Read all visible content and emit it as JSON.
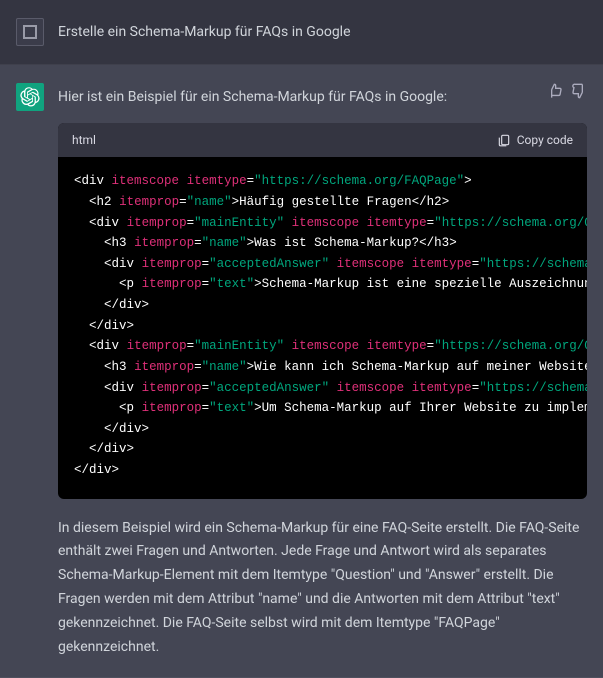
{
  "user": {
    "prompt": "Erstelle ein Schema-Markup für FAQs in Google"
  },
  "assistant": {
    "intro": "Hier ist ein Beispiel für ein Schema-Markup für FAQs in Google:",
    "explanation": "In diesem Beispiel wird ein Schema-Markup für eine FAQ-Seite erstellt. Die FAQ-Seite enthält zwei Fragen und Antworten. Jede Frage und Antwort wird als separates Schema-Markup-Element mit dem Itemtype \"Question\" und \"Answer\" erstellt. Die Fragen werden mit dem Attribut \"name\" und die Antworten mit dem Attribut \"text\" gekennzeichnet. Die FAQ-Seite selbst wird mit dem Itemtype \"FAQPage\" gekennzeichnet."
  },
  "code": {
    "lang": "html",
    "copy_label": "Copy code",
    "t": {
      "div": "div",
      "h2": "h2",
      "h3": "h3",
      "p": "p",
      "cdiv": "/div",
      "ch2": "/h2",
      "ch3": "/h3",
      "cp": "/p",
      "itemscope": "itemscope",
      "itemtype": "itemtype",
      "itemprop": "itemprop",
      "url_faqpage": "\"https://schema.org/FAQPage\"",
      "url_question_trunc": "\"https://schema.org/Questio",
      "url_answer_trunc": "\"https://schema.org/A",
      "v_name": "\"name\"",
      "v_mainEntity": "\"mainEntity\"",
      "v_acceptedAnswer": "\"acceptedAnswer\"",
      "v_text": "\"text\"",
      "txt_h2": "Häufig gestellte Fragen",
      "txt_q1": "Was ist Schema-Markup?",
      "txt_a1": "Schema-Markup ist eine spezielle Auszeichnungsspra",
      "txt_q2": "Wie kann ich Schema-Markup auf meiner Website imple",
      "txt_a2": "Um Schema-Markup auf Ihrer Website zu implementiere"
    }
  }
}
